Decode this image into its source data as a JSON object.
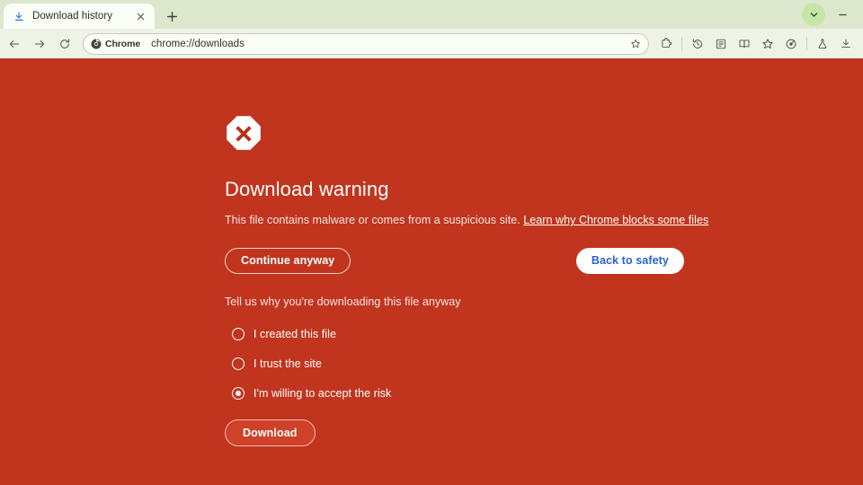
{
  "window": {
    "tab": {
      "title": "Download history",
      "favicon": "download-icon",
      "close_icon": "close-icon"
    },
    "new_tab_label": "+",
    "controls": {
      "chevron": "chevron-down-icon",
      "minimize": "minimize-icon"
    }
  },
  "toolbar": {
    "back": "back-arrow-icon",
    "forward": "forward-arrow-icon",
    "reload": "reload-icon",
    "omnibox": {
      "chip_icon": "chrome-logo-icon",
      "chip_label": "Chrome",
      "url": "chrome://downloads",
      "bookmark_icon": "star-icon"
    },
    "actions": [
      {
        "name": "extensions-icon",
        "label": "Extensions"
      },
      {
        "name": "history-icon",
        "label": "History"
      },
      {
        "name": "reading-list-icon",
        "label": "Reading list"
      },
      {
        "name": "bookmarks-icon",
        "label": "Bookmarks"
      },
      {
        "name": "star-outline-icon",
        "label": "Saved"
      },
      {
        "name": "profile-icon",
        "label": "Profile"
      },
      {
        "name": "flask-icon",
        "label": "Experiments"
      },
      {
        "name": "downloads-icon",
        "label": "Downloads"
      }
    ]
  },
  "page": {
    "icon": "error-octagon-icon",
    "title": "Download warning",
    "subtitle_text": "This file contains malware or comes from a suspicious site.",
    "learn_more_link": "Learn why Chrome blocks some files",
    "continue_button": "Continue anyway",
    "safety_button": "Back to safety",
    "prompt": "Tell us why you're downloading this file anyway",
    "reasons": [
      {
        "label": "I created this file",
        "selected": false
      },
      {
        "label": "I trust the site",
        "selected": false
      },
      {
        "label": "I'm willing to accept the risk",
        "selected": true
      }
    ],
    "download_button": "Download",
    "colors": {
      "background": "#c1351e",
      "link": "#ffffff",
      "safety_text": "#2f61d5",
      "tabstrip": "#dde7ce"
    }
  }
}
